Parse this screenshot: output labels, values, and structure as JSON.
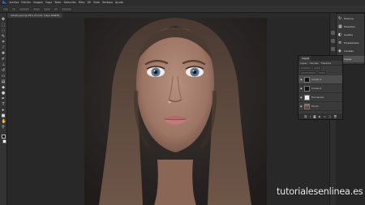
{
  "menubar": {
    "logo": "Ps",
    "items": [
      "Archivo",
      "Edición",
      "Imagen",
      "Capa",
      "Texto",
      "Selección",
      "Filtro",
      "3D",
      "Vista",
      "Ventana",
      "Ayuda"
    ]
  },
  "tabs": [
    {
      "label": "retrato.psd @ 50% (Fondo, Capa RGB/8)"
    }
  ],
  "toolbar": {
    "tools": [
      {
        "icon": "move-icon",
        "glyph": "✥"
      },
      {
        "icon": "marquee-icon",
        "glyph": "⬚"
      },
      {
        "icon": "lasso-icon",
        "glyph": "◌"
      },
      {
        "icon": "quick-select-icon",
        "glyph": "✎"
      },
      {
        "icon": "crop-icon",
        "glyph": "⌗"
      },
      {
        "icon": "eyedropper-icon",
        "glyph": "⁄"
      },
      {
        "icon": "healing-brush-icon",
        "glyph": "✚"
      },
      {
        "icon": "brush-icon",
        "glyph": "✐"
      },
      {
        "icon": "clone-stamp-icon",
        "glyph": "⊥"
      },
      {
        "icon": "history-brush-icon",
        "glyph": "↺"
      },
      {
        "icon": "eraser-icon",
        "glyph": "▭"
      },
      {
        "icon": "gradient-icon",
        "glyph": "▤"
      },
      {
        "icon": "blur-icon",
        "glyph": "◆"
      },
      {
        "icon": "dodge-icon",
        "glyph": "●"
      },
      {
        "icon": "pen-icon",
        "glyph": "✒"
      },
      {
        "icon": "type-icon",
        "glyph": "T"
      },
      {
        "icon": "path-select-icon",
        "glyph": "▸"
      },
      {
        "icon": "shape-icon",
        "glyph": "■"
      },
      {
        "icon": "hand-icon",
        "glyph": "✋"
      },
      {
        "icon": "zoom-icon",
        "glyph": "⚲"
      }
    ]
  },
  "nav_panel": {
    "items": [
      {
        "icon": "history-icon",
        "glyph": "↻",
        "label": "Historia"
      },
      {
        "icon": "swatches-icon",
        "glyph": "▦",
        "label": "Muestras"
      },
      {
        "icon": "adjustments-icon",
        "glyph": "◐",
        "label": "Ajustes"
      },
      {
        "icon": "properties-icon",
        "glyph": "≡",
        "label": "Propiedades"
      },
      {
        "icon": "channels-icon",
        "glyph": "◈",
        "label": "Canales"
      },
      {
        "icon": "layers-icon",
        "glyph": "❐",
        "label": "Capas"
      }
    ],
    "selected_index": 5
  },
  "layers_panel": {
    "title": "Capas",
    "tabs": [
      "Capas",
      "Canales",
      "Trazados"
    ],
    "layers": [
      {
        "name": "Curvas 1",
        "thumb": "dark",
        "selected": true
      },
      {
        "name": "Curvas 2",
        "thumb": "dark",
        "selected": false
      },
      {
        "name": "Frecuencia",
        "thumb": "white",
        "selected": false
      },
      {
        "name": "Fondo",
        "thumb": "img",
        "selected": false
      }
    ],
    "footer_icons": [
      "link-icon",
      "fx-icon",
      "mask-icon",
      "adjustment-icon",
      "folder-icon",
      "new-layer-icon",
      "trash-icon"
    ]
  },
  "watermark": "tutorialesenlinea.es"
}
